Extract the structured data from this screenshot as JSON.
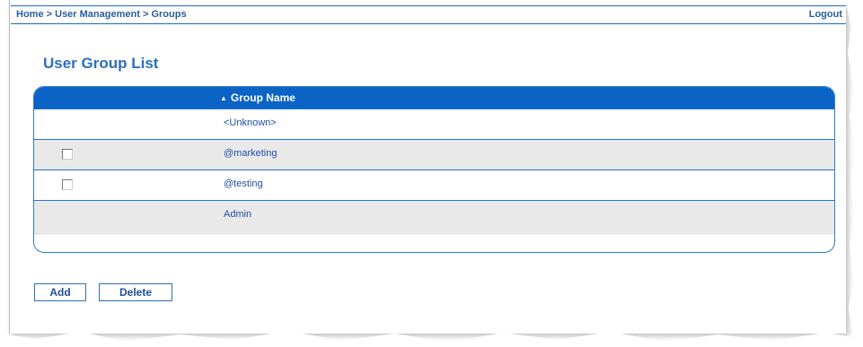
{
  "header": {
    "breadcrumb": [
      "Home",
      "User Management",
      "Groups"
    ],
    "breadcrumb_sep": ">",
    "logout_label": "Logout"
  },
  "main": {
    "title": "User Group List",
    "table": {
      "sort_icon": "sort-ascending-icon",
      "column_header": "Group Name",
      "rows": [
        {
          "name": "<Unknown>",
          "checkbox": false
        },
        {
          "name": "@marketing",
          "checkbox": true,
          "checked": false
        },
        {
          "name": "@testing",
          "checkbox": true,
          "checked": false
        },
        {
          "name": "Admin",
          "checkbox": false
        }
      ]
    },
    "buttons": {
      "add_label": "Add",
      "delete_label": "Delete"
    }
  },
  "colors": {
    "header_blue": "#0b63c6",
    "title_blue": "#2b6fba",
    "link_blue": "#1f4ea3",
    "row_alt": "#e9e9e9"
  }
}
